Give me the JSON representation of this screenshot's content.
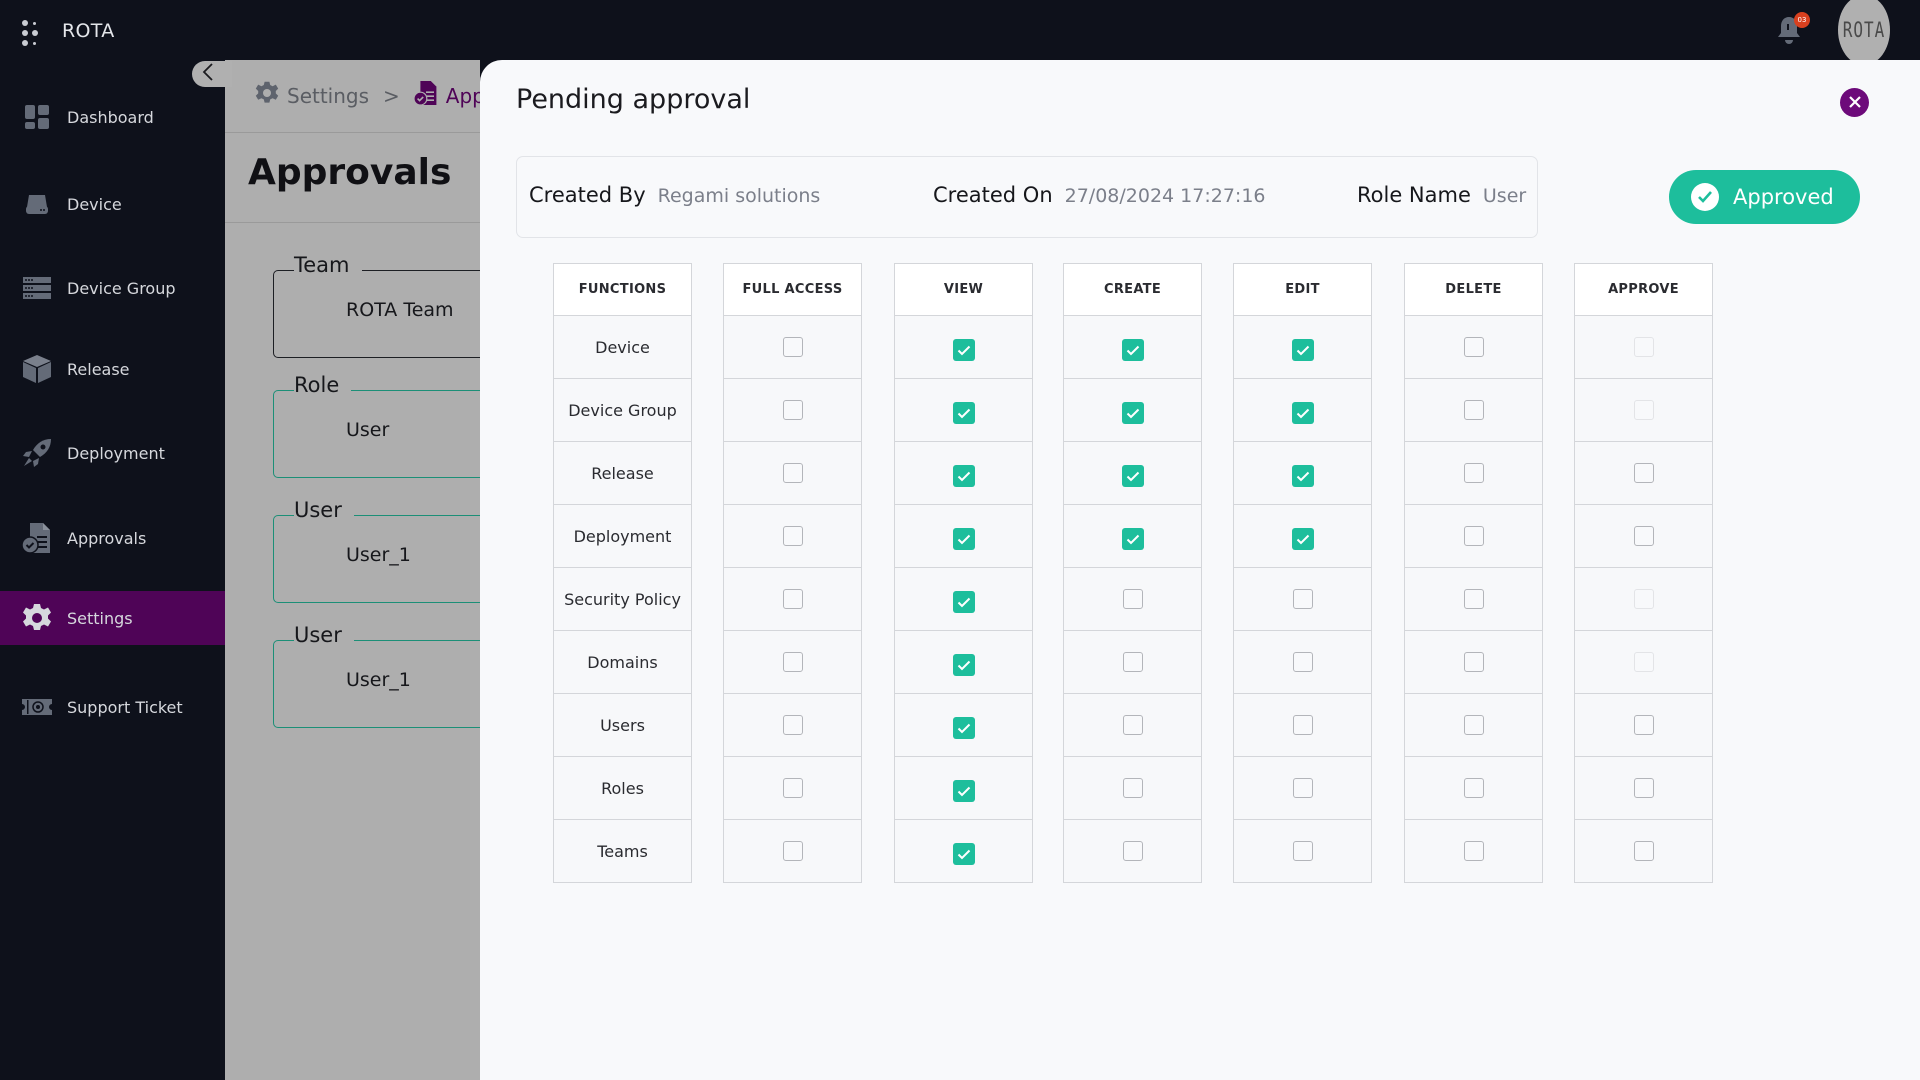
{
  "app": {
    "title": "ROTA",
    "notification_count": "03",
    "avatar_text": "ROTA"
  },
  "sidebar": {
    "collapse_icon": "chevron-left-icon",
    "items": [
      {
        "label": "Dashboard",
        "icon": "dashboard-icon",
        "active": false
      },
      {
        "label": "Device",
        "icon": "device-icon",
        "active": false
      },
      {
        "label": "Device Group",
        "icon": "device-group-icon",
        "active": false
      },
      {
        "label": "Release",
        "icon": "release-box-icon",
        "active": false
      },
      {
        "label": "Deployment",
        "icon": "rocket-icon",
        "active": false
      },
      {
        "label": "Approvals",
        "icon": "approvals-icon",
        "active": false
      },
      {
        "label": "Settings",
        "icon": "gear-icon",
        "active": true
      },
      {
        "label": "Support Ticket",
        "icon": "ticket-icon",
        "active": false
      }
    ]
  },
  "page": {
    "breadcrumb": [
      {
        "label": "Settings",
        "icon": "gear-icon"
      },
      {
        "label": "Appr",
        "icon": "approvals-icon"
      }
    ],
    "breadcrumb_separator": ">",
    "title": "Approvals",
    "fields": [
      {
        "legend": "Team",
        "value": "ROTA Team"
      },
      {
        "legend": "Role",
        "value": "User"
      },
      {
        "legend": "User",
        "value": "User_1"
      },
      {
        "legend": "User",
        "value": "User_1"
      }
    ]
  },
  "modal": {
    "title": "Pending approval",
    "created_by_label": "Created By",
    "created_by": "Regami solutions",
    "created_on_label": "Created On",
    "created_on": "27/08/2024 17:27:16",
    "role_name_label": "Role Name",
    "role_name": "User",
    "status": "Approved",
    "colors": {
      "accent": "#1dbe9c",
      "brand": "#4f0457",
      "close": "#6d0a7a"
    }
  },
  "permissions": {
    "columns": [
      "FUNCTIONS",
      "FULL ACCESS",
      "VIEW",
      "CREATE",
      "EDIT",
      "DELETE",
      "APPROVE"
    ],
    "rows": [
      {
        "function": "Device",
        "full_access": false,
        "view": true,
        "create": true,
        "edit": true,
        "delete": false,
        "approve": false,
        "approve_disabled": true
      },
      {
        "function": "Device Group",
        "full_access": false,
        "view": true,
        "create": true,
        "edit": true,
        "delete": false,
        "approve": false,
        "approve_disabled": true
      },
      {
        "function": "Release",
        "full_access": false,
        "view": true,
        "create": true,
        "edit": true,
        "delete": false,
        "approve": false,
        "approve_disabled": false
      },
      {
        "function": "Deployment",
        "full_access": false,
        "view": true,
        "create": true,
        "edit": true,
        "delete": false,
        "approve": false,
        "approve_disabled": false
      },
      {
        "function": "Security Policy",
        "full_access": false,
        "view": true,
        "create": false,
        "edit": false,
        "delete": false,
        "approve": false,
        "approve_disabled": true
      },
      {
        "function": "Domains",
        "full_access": false,
        "view": true,
        "create": false,
        "edit": false,
        "delete": false,
        "approve": false,
        "approve_disabled": true
      },
      {
        "function": "Users",
        "full_access": false,
        "view": true,
        "create": false,
        "edit": false,
        "delete": false,
        "approve": false,
        "approve_disabled": false
      },
      {
        "function": "Roles",
        "full_access": false,
        "view": true,
        "create": false,
        "edit": false,
        "delete": false,
        "approve": false,
        "approve_disabled": false
      },
      {
        "function": "Teams",
        "full_access": false,
        "view": true,
        "create": false,
        "edit": false,
        "delete": false,
        "approve": false,
        "approve_disabled": false
      }
    ]
  }
}
